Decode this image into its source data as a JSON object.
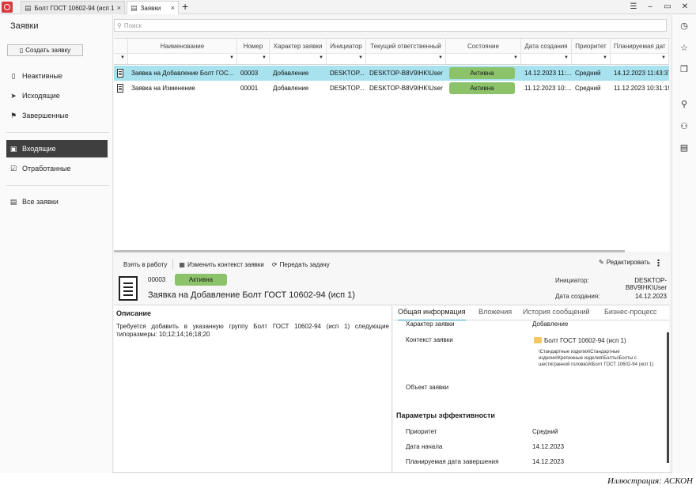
{
  "titlebar": {
    "tabs": [
      {
        "label": "Болт ГОСТ 10602-94 (исп 1)",
        "icon": "document-icon"
      },
      {
        "label": "Заявки",
        "icon": "document-icon"
      }
    ],
    "close_glyph": "×",
    "add_glyph": "+",
    "controls": {
      "menu": "☰",
      "minimize": "–",
      "maximize": "▭",
      "close": "✕"
    }
  },
  "sidebar": {
    "title": "Заявки",
    "create_button": "Создать заявку",
    "items": [
      {
        "label": "Неактивные",
        "icon": "document-icon",
        "glyph": "▯"
      },
      {
        "label": "Исходящие",
        "icon": "send-icon",
        "glyph": "➤"
      },
      {
        "label": "Завершенные",
        "icon": "flag-icon",
        "glyph": "⚑"
      },
      {
        "label": "Входящие",
        "icon": "inbox-icon",
        "glyph": "▣"
      },
      {
        "label": "Отработанные",
        "icon": "checked-inbox-icon",
        "glyph": "☑"
      },
      {
        "label": "Все заявки",
        "icon": "all-requests-icon",
        "glyph": "▤"
      }
    ]
  },
  "search": {
    "placeholder": "Поиск",
    "icon": "search-icon"
  },
  "table": {
    "columns": [
      "Наименование",
      "Номер",
      "Характер заявки",
      "Инициатор",
      "Текущий ответственный",
      "Состояние",
      "Дата создания",
      "Приоритет",
      "Планируемая дат"
    ],
    "rows": [
      {
        "name": "Заявка на Добавление Болт ГОС...",
        "number": "00003",
        "kind": "Добавление",
        "initiator": "DESKTOP...",
        "responsible": "DESKTOP-B8V9IHK\\User",
        "state": "Активна",
        "created": "14.12.2023 11:...",
        "priority": "Средний",
        "planned": "14.12.2023 11:43:37"
      },
      {
        "name": "Заявка на Изменение",
        "number": "00001",
        "kind": "Добавление",
        "initiator": "DESKTOP...",
        "responsible": "DESKTOP-B8V9IHK\\User",
        "state": "Активна",
        "created": "11.12.2023 10:...",
        "priority": "Средний",
        "planned": "11.12.2023 10:31:19"
      }
    ]
  },
  "toolbar": {
    "take_to_work": "Взять в работу",
    "change_context": "Изменить контекст заявки",
    "pass_task": "Передать задачу",
    "edit": "Редактировать",
    "more": "⋮"
  },
  "card": {
    "number": "00003",
    "state": "Активна",
    "title": "Заявка на Добавление Болт ГОСТ 10602-94 (исп 1)",
    "initiator_label": "Инициатор:",
    "initiator_value": "DESKTOP-B8V9IHK\\User",
    "created_label": "Дата создания:",
    "created_value": "14.12.2023"
  },
  "description": {
    "heading": "Описание",
    "text": "Требуется добавить в указанную группу Болт ГОСТ 10602-94 (исп 1) следующие типоразмеры: 10;12;14;16;18;20"
  },
  "detail_tabs": [
    "Общая информация",
    "Вложения",
    "История сообщений",
    "Бизнес-процесс"
  ],
  "general_info": {
    "kind_label": "Характер заявки",
    "kind_value": "Добавление",
    "context_label": "Контекст заявки",
    "context_value": "Болт ГОСТ 10602-94 (исп 1)",
    "context_path": "\\Стандартные изделия\\Стандартные изделия\\Крепежные изделия\\Болты\\Болты с шестигранной головкой\\Болт ГОСТ 10602-94 (исп 1)",
    "object_label": "Объект заявки",
    "efficiency_heading": "Параметры эффективности",
    "priority_label": "Приоритет",
    "priority_value": "Средний",
    "start_label": "Дата начала",
    "start_value": "14.12.2023",
    "planned_end_label": "Планируемая дата завершения",
    "planned_end_value": "14.12.2023"
  },
  "credit": "Иллюстрация: АСКОН",
  "colors": {
    "selected_row": "#a8e2ef",
    "status_active": "#8bc26a",
    "sidebar_active": "#3f3f3f",
    "tab_accent": "#2aa1c9",
    "logo": "#d8393b"
  }
}
